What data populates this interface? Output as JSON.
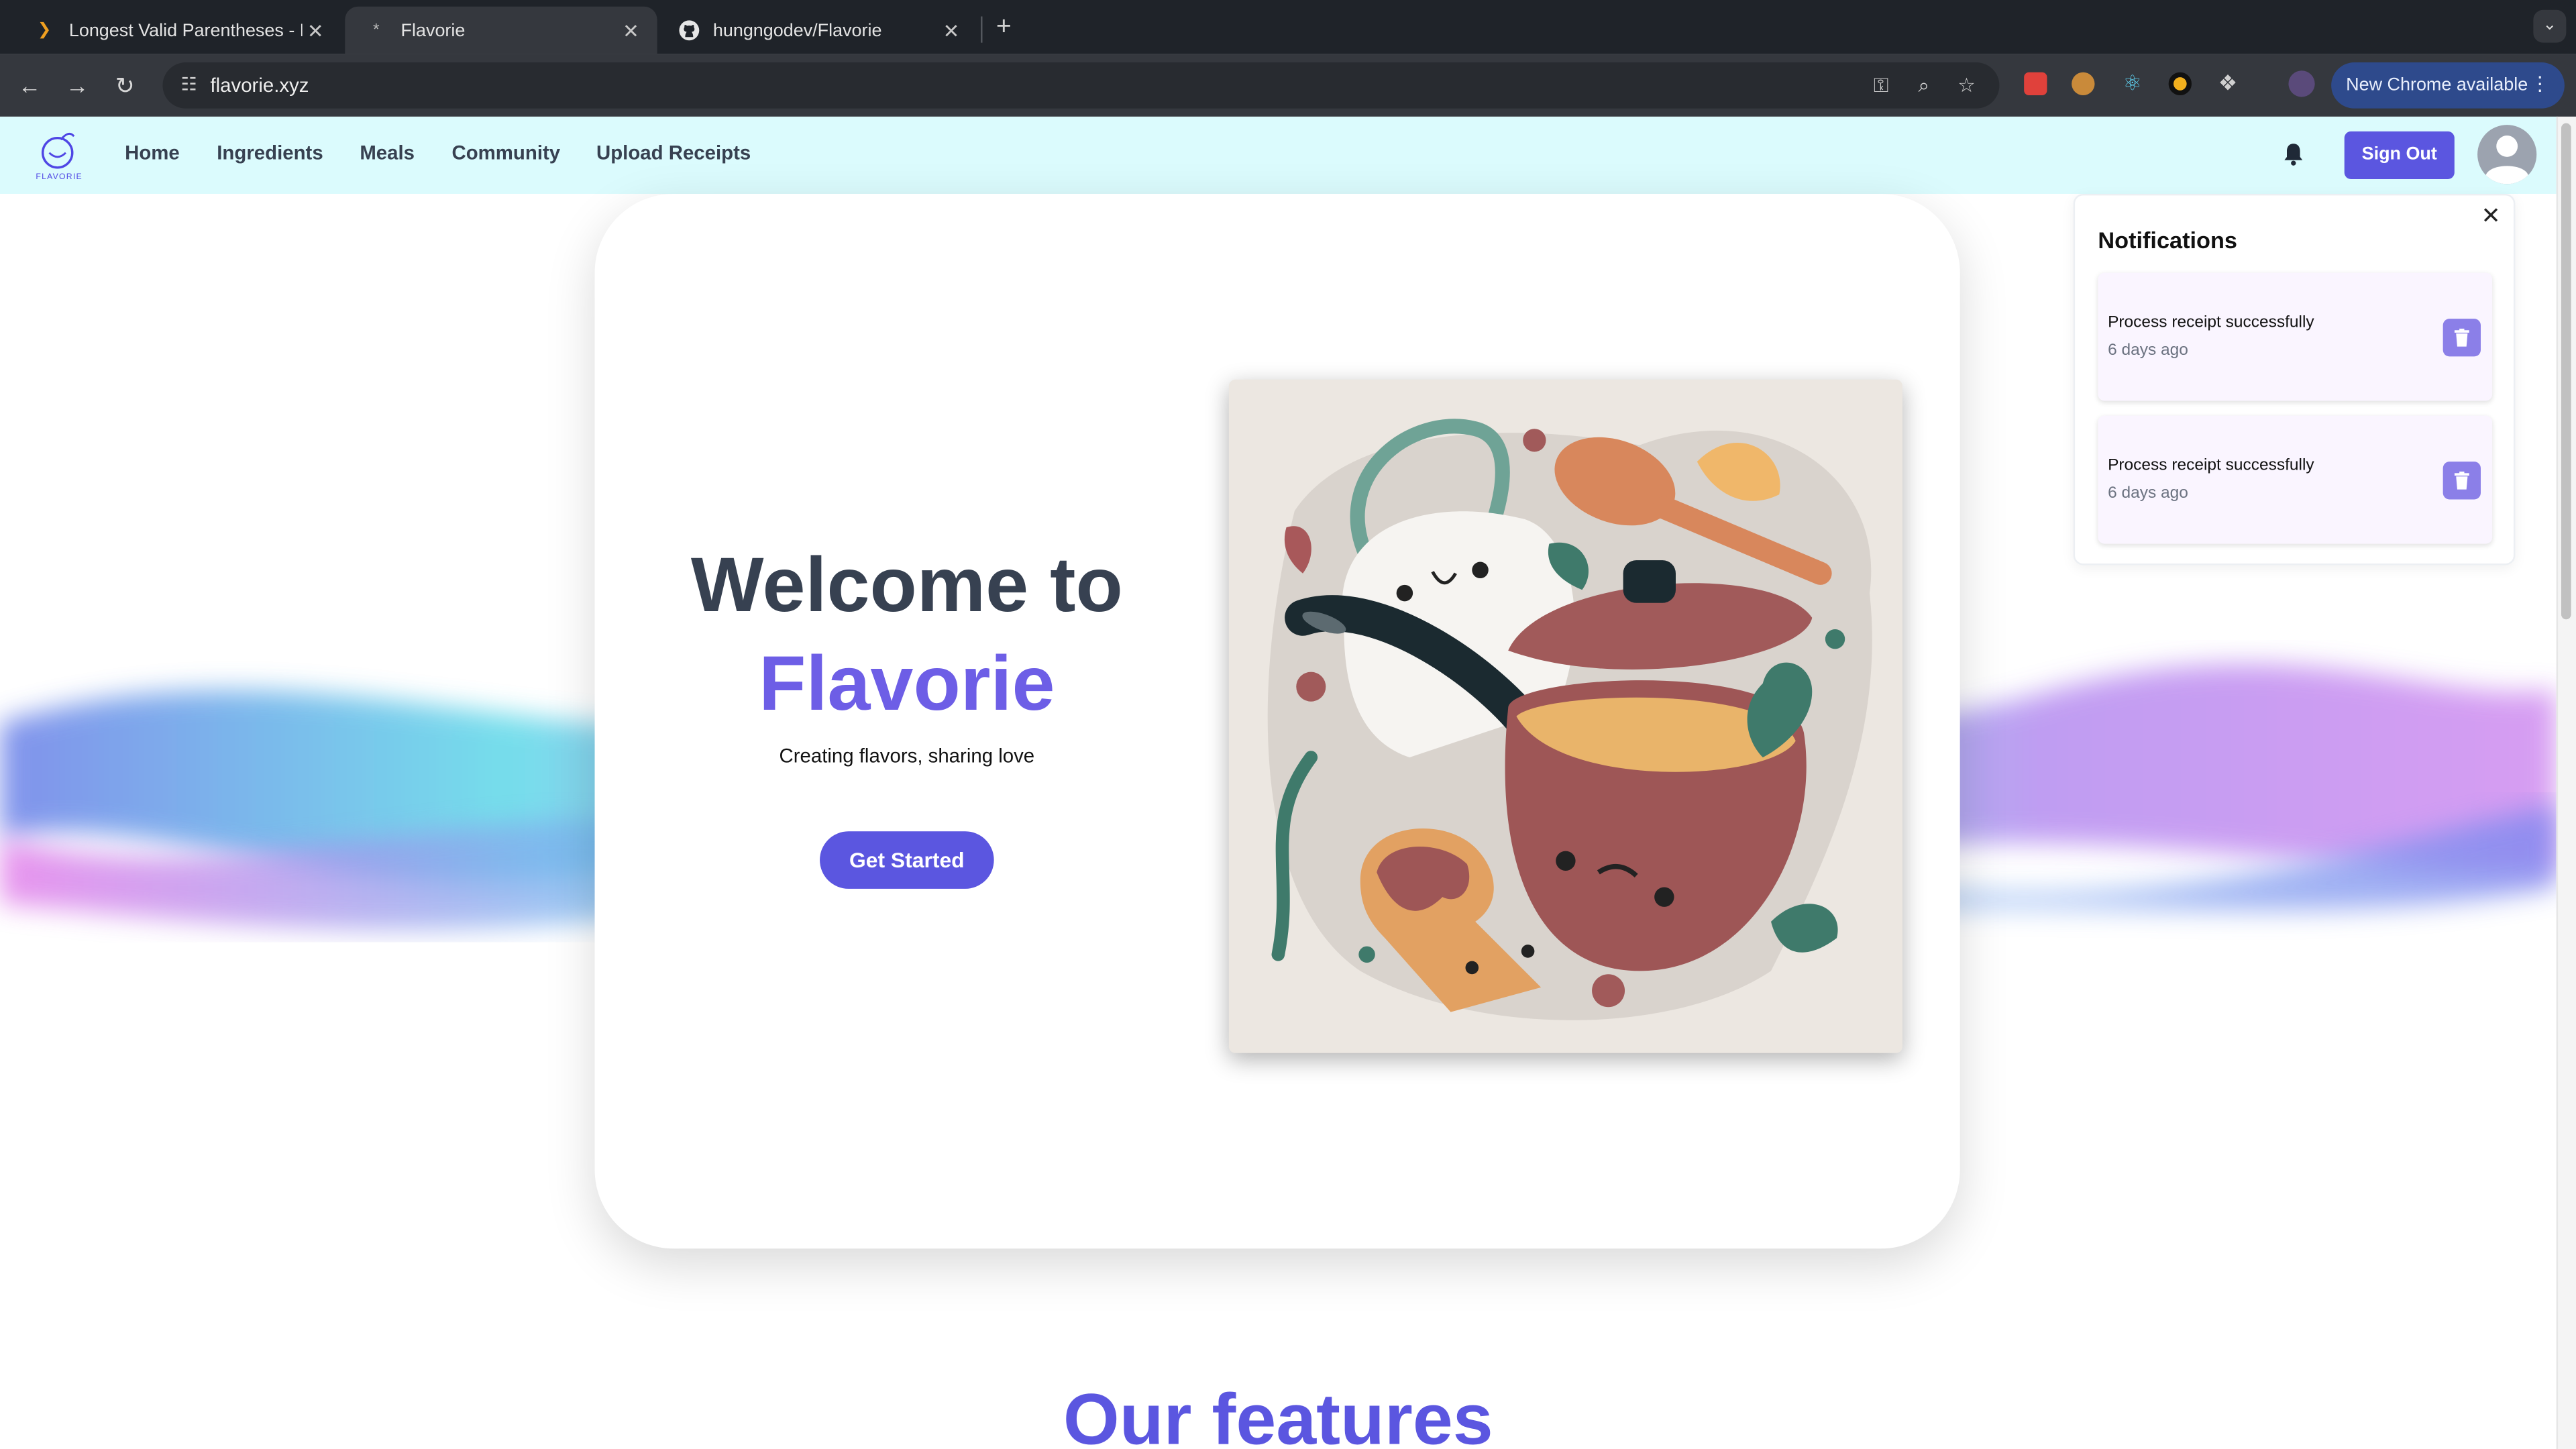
{
  "browser": {
    "tabs": [
      {
        "title": "Longest Valid Parentheses - L",
        "icon": "leetcode-icon"
      },
      {
        "title": "Flavorie",
        "icon": "flavorie-icon"
      },
      {
        "title": "hungngodev/Flavorie",
        "icon": "github-icon"
      }
    ],
    "url": "flavorie.xyz",
    "new_chrome_label": "New Chrome available"
  },
  "app": {
    "logo_text": "FLAVORIE",
    "nav": [
      "Home",
      "Ingredients",
      "Meals",
      "Community",
      "Upload Receipts"
    ],
    "sign_out_label": "Sign Out"
  },
  "hero": {
    "title_line1": "Welcome to",
    "title_line2": "Flavorie",
    "tagline": "Creating flavors, sharing love",
    "cta_label": "Get Started"
  },
  "features_heading": "Our features",
  "notifications": {
    "title": "Notifications",
    "items": [
      {
        "message": "Process receipt successfully",
        "time": "6 days ago"
      },
      {
        "message": "Process receipt successfully",
        "time": "6 days ago"
      }
    ]
  },
  "colors": {
    "accent": "#5b56e0",
    "header_bg": "#dbfbfd",
    "title_dark": "#374151",
    "title_accent": "#6d5ee6"
  }
}
